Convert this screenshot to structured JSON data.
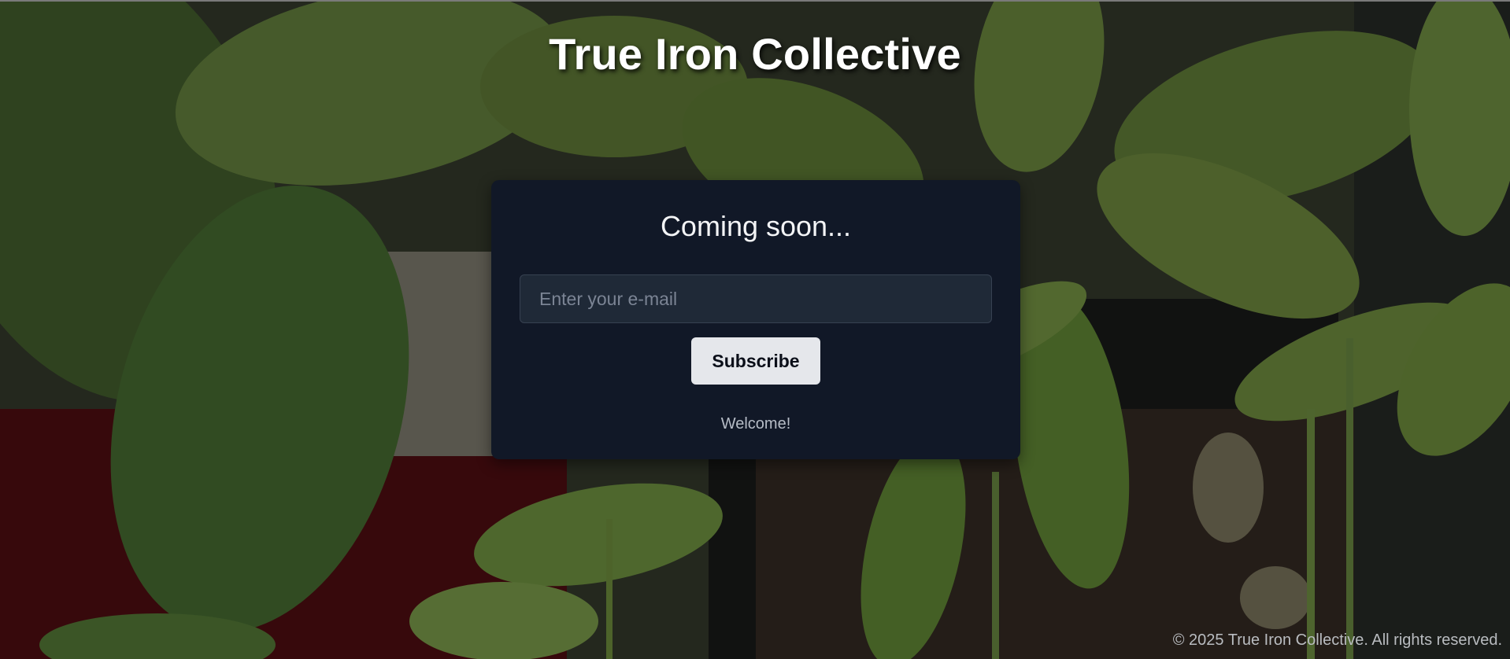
{
  "header": {
    "title": "True Iron Collective"
  },
  "signup": {
    "heading": "Coming soon...",
    "email_placeholder": "Enter your e-mail",
    "email_value": "",
    "subscribe_label": "Subscribe",
    "status_message": "Welcome!"
  },
  "footer": {
    "copyright": "© 2025 True Iron Collective. All rights reserved."
  },
  "colors": {
    "card_background": "#111827",
    "input_background": "#1f2937",
    "button_background": "#e5e7eb",
    "title_text": "#ffffff"
  }
}
